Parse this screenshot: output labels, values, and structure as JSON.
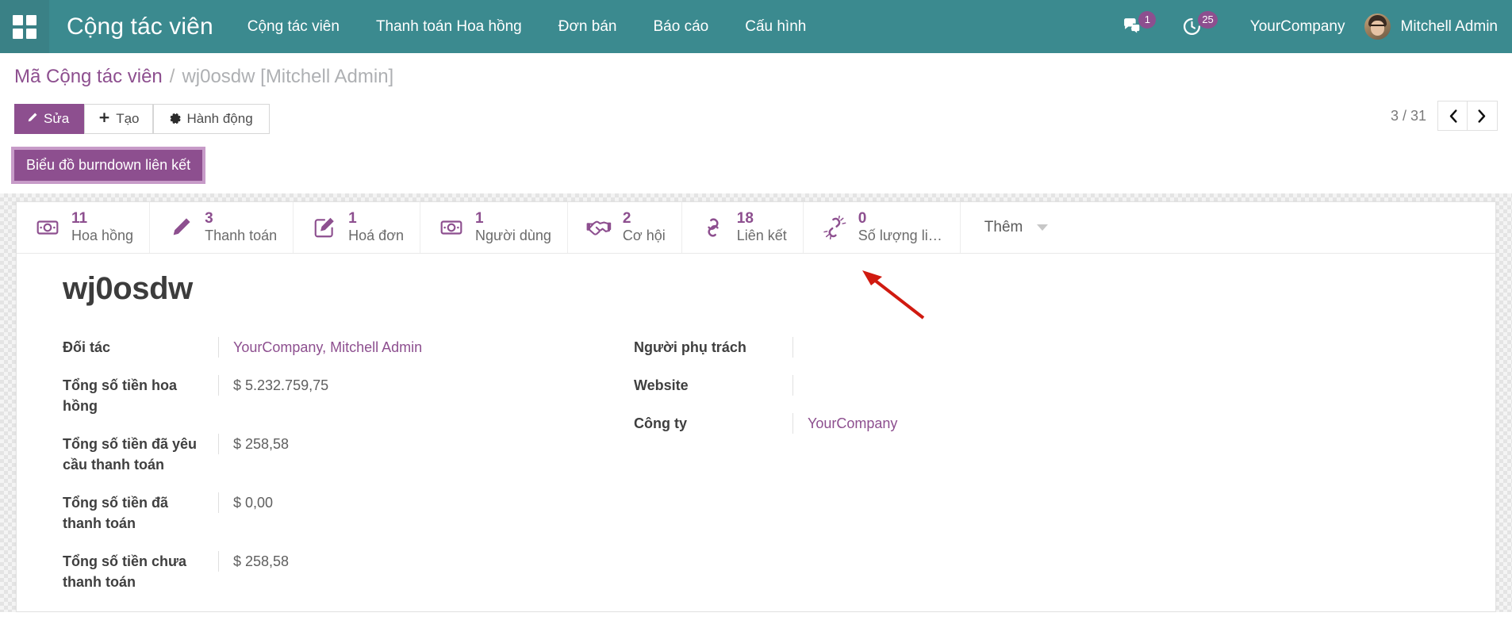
{
  "navbar": {
    "apps_icon": "grid-apps-icon",
    "brand": "Cộng tác viên",
    "menu": [
      {
        "label": "Cộng tác viên"
      },
      {
        "label": "Thanh toán Hoa hồng"
      },
      {
        "label": "Đơn bán"
      },
      {
        "label": "Báo cáo"
      },
      {
        "label": "Cấu hình"
      }
    ],
    "messages_icon": "chat-bubble-icon",
    "messages_count": "1",
    "activities_icon": "clock-activity-icon",
    "activities_count": "25",
    "company": "YourCompany",
    "avatar_icon": "user-avatar",
    "user": "Mitchell Admin"
  },
  "breadcrumb": {
    "root": "Mã Cộng tác viên",
    "separator": "/",
    "current": "wj0osdw [Mitchell Admin]"
  },
  "control_panel": {
    "edit_label": "Sửa",
    "edit_icon": "pencil-icon",
    "create_label": "Tạo",
    "create_icon": "plus-icon",
    "action_label": "Hành động",
    "action_icon": "gear-icon",
    "pager_text": "3 / 31",
    "prev_icon": "chevron-left-icon",
    "next_icon": "chevron-right-icon"
  },
  "burndown_button": {
    "label": "Biểu đồ burndown liên kết"
  },
  "stat_buttons": [
    {
      "value": "11",
      "label": "Hoa hồng",
      "icon": "money-bill-icon"
    },
    {
      "value": "3",
      "label": "Thanh toán",
      "icon": "pencil-icon"
    },
    {
      "value": "1",
      "label": "Hoá đơn",
      "icon": "edit-square-icon"
    },
    {
      "value": "1",
      "label": "Người dùng",
      "icon": "money-bill-icon"
    },
    {
      "value": "2",
      "label": "Cơ hội",
      "icon": "handshake-icon"
    },
    {
      "value": "18",
      "label": "Liên kết",
      "icon": "chain-link-icon"
    },
    {
      "value": "0",
      "label": "Số lượng liên ...",
      "icon": "chain-broken-icon"
    }
  ],
  "stat_more": {
    "label": "Thêm",
    "caret_icon": "chevron-down-icon"
  },
  "record": {
    "title": "wj0osdw",
    "left_fields": [
      {
        "label": "Đối tác",
        "value": "YourCompany, Mitchell Admin",
        "is_link": true
      },
      {
        "label": "Tổng số tiền hoa hồng",
        "value": "$ 5.232.759,75",
        "is_link": false
      },
      {
        "label": "Tổng số tiền đã yêu cầu thanh toán",
        "value": "$ 258,58",
        "is_link": false
      },
      {
        "label": "Tổng số tiền đã thanh toán",
        "value": "$ 0,00",
        "is_link": false
      },
      {
        "label": "Tổng số tiền chưa thanh toán",
        "value": "$ 258,58",
        "is_link": false
      }
    ],
    "right_fields": [
      {
        "label": "Người phụ trách",
        "value": "",
        "is_link": false
      },
      {
        "label": "Website",
        "value": "",
        "is_link": false
      },
      {
        "label": "Công ty",
        "value": "YourCompany",
        "is_link": true
      }
    ]
  },
  "annotation": {
    "arrow_icon": "red-arrow-pointer"
  },
  "colors": {
    "navbar": "#3b8a8f",
    "accent_purple": "#8d4f8f",
    "annotation_red": "#d01a10",
    "text": "#4c4c4c"
  }
}
